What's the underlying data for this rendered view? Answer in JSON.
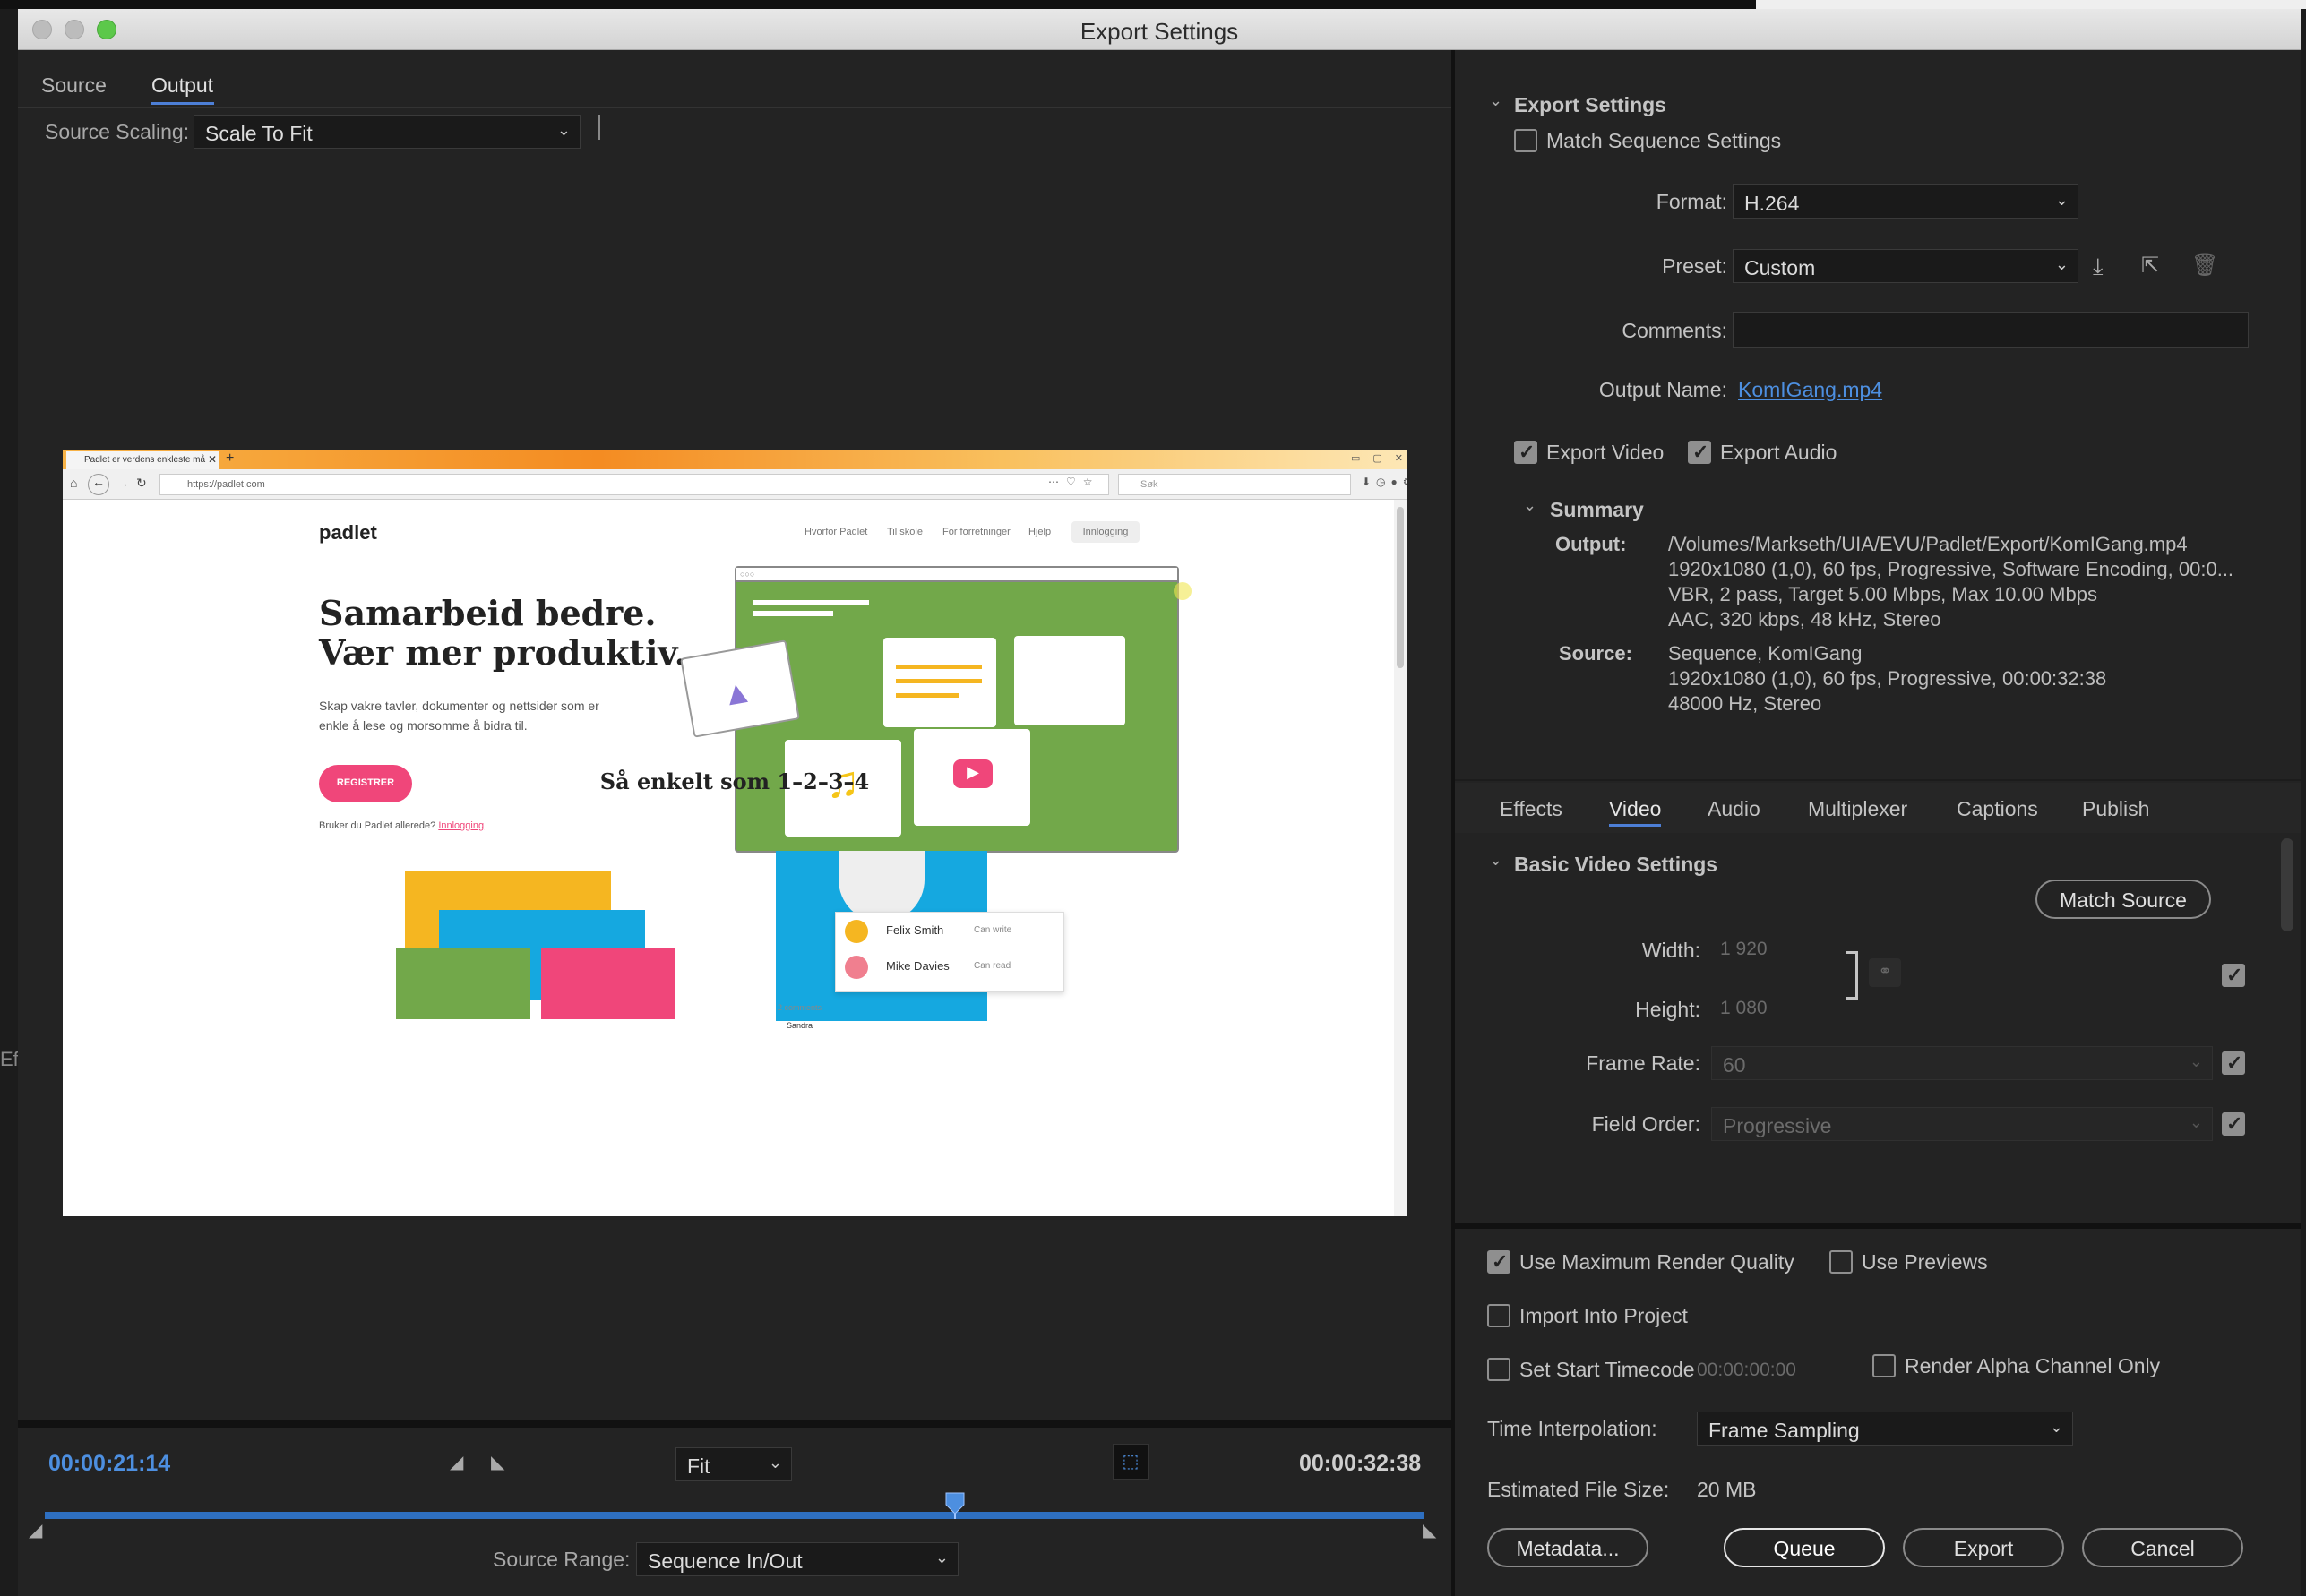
{
  "window": {
    "title": "Export Settings"
  },
  "left_tabs": [
    {
      "label": "Source"
    },
    {
      "label": "Output"
    }
  ],
  "source_scaling": {
    "label": "Source Scaling:",
    "value": "Scale To Fit"
  },
  "browser": {
    "tab_title": "Padlet er verdens enkleste må",
    "url": "https://padlet.com",
    "search_placeholder": "Søk",
    "site": {
      "logo": "padlet",
      "nav": [
        "Hvorfor Padlet",
        "Til skole",
        "For forretninger",
        "Hjelp",
        "Innlogging"
      ],
      "headline_1": "Samarbeid bedre.",
      "headline_2": "Vær mer produktiv.",
      "desc_1": "Skap vakre tavler, dokumenter og nettsider som er",
      "desc_2": "enkle å lese og morsomme å bidra til.",
      "register": "REGISTRER",
      "login_prompt": "Bruker du Padlet allerede?",
      "login_link": "Innlogging",
      "section_title": "Så enkelt som 1–2–3–4",
      "users": [
        {
          "name": "Felix Smith",
          "perm": "Can write"
        },
        {
          "name": "Mike Davies",
          "perm": "Can read"
        }
      ],
      "comments": "2 comments",
      "commenter": "Sandra"
    }
  },
  "timeline": {
    "current_time": "00:00:21:14",
    "end_time": "00:00:32:38",
    "zoom": "Fit",
    "playhead_fraction": 0.66,
    "source_range_label": "Source Range:",
    "source_range_value": "Sequence In/Out"
  },
  "export_settings": {
    "heading": "Export Settings",
    "match_sequence": "Match Sequence Settings",
    "format_label": "Format:",
    "format_value": "H.264",
    "preset_label": "Preset:",
    "preset_value": "Custom",
    "comments_label": "Comments:",
    "comments_value": "",
    "output_name_label": "Output Name:",
    "output_name_value": "KomIGang.mp4",
    "export_video": "Export Video",
    "export_audio": "Export Audio",
    "summary": {
      "heading": "Summary",
      "output_label": "Output:",
      "output_lines": [
        "/Volumes/Markseth/UIA/EVU/Padlet/Export/KomIGang.mp4",
        "1920x1080 (1,0), 60 fps, Progressive, Software Encoding, 00:0...",
        "VBR, 2 pass, Target 5.00 Mbps, Max 10.00 Mbps",
        "AAC, 320 kbps, 48 kHz, Stereo"
      ],
      "source_label": "Source:",
      "source_lines": [
        "Sequence, KomIGang",
        "1920x1080 (1,0), 60 fps, Progressive, 00:00:32:38",
        "48000 Hz, Stereo"
      ]
    }
  },
  "settings_tabs": [
    "Effects",
    "Video",
    "Audio",
    "Multiplexer",
    "Captions",
    "Publish"
  ],
  "video": {
    "heading": "Basic Video Settings",
    "match_source": "Match Source",
    "width_label": "Width:",
    "width_value": "1 920",
    "height_label": "Height:",
    "height_value": "1 080",
    "frame_rate_label": "Frame Rate:",
    "frame_rate_value": "60",
    "field_order_label": "Field Order:",
    "field_order_value": "Progressive"
  },
  "bottom": {
    "max_render": "Use Maximum Render Quality",
    "use_previews": "Use Previews",
    "import_project": "Import Into Project",
    "start_timecode": "Set Start Timecode",
    "timecode_value": "00:00:00:00",
    "alpha_only": "Render Alpha Channel Only",
    "interp_label": "Time Interpolation:",
    "interp_value": "Frame Sampling",
    "size_label": "Estimated File Size:",
    "size_value": "20 MB",
    "metadata": "Metadata...",
    "queue": "Queue",
    "export": "Export",
    "cancel": "Cancel"
  },
  "colors": {
    "accent_blue": "#4d8fe0",
    "padlet_pink": "#f0467a",
    "illus_green": "#72a84a"
  }
}
